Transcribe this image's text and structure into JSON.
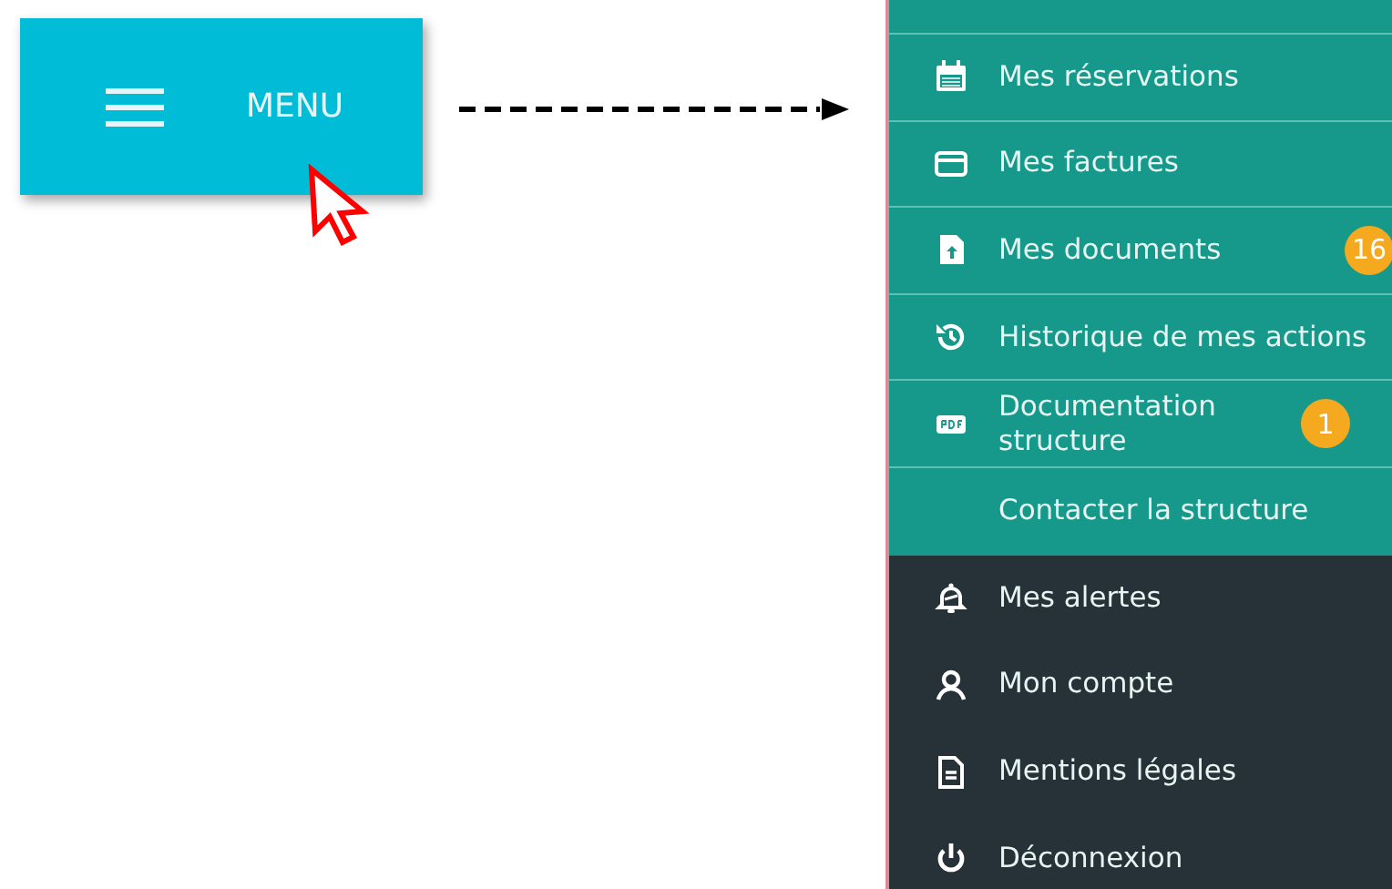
{
  "menu_button": {
    "label": "MENU"
  },
  "menu_items": [
    {
      "label": "Mes réservations",
      "kind": "calendar"
    },
    {
      "label": "Mes factures",
      "kind": "card"
    },
    {
      "label": "Mes documents",
      "kind": "document",
      "badge": "16"
    },
    {
      "label": "Historique de mes actions",
      "kind": "history"
    },
    {
      "label": "Documentation structure",
      "kind": "pdf",
      "badge": "1"
    },
    {
      "label": "Contacter la structure",
      "kind": "none"
    }
  ],
  "account_items": [
    {
      "label": "Mes alertes",
      "kind": "bell"
    },
    {
      "label": "Mon compte",
      "kind": "user"
    },
    {
      "label": "Mentions légales",
      "kind": "file"
    },
    {
      "label": "Déconnexion",
      "kind": "power"
    }
  ]
}
